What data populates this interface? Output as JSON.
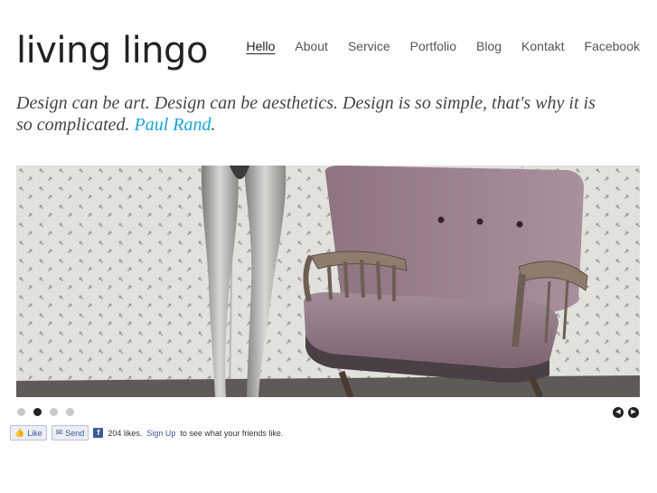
{
  "header": {
    "logo": "living lingo"
  },
  "nav": [
    {
      "label": "Hello",
      "active": true
    },
    {
      "label": "About"
    },
    {
      "label": "Service"
    },
    {
      "label": "Portfolio"
    },
    {
      "label": "Blog"
    },
    {
      "label": "Kontakt"
    },
    {
      "label": "Facebook"
    }
  ],
  "quote": {
    "text": "Design can be art. Design can be aesthetics. Design is so simple, that's why it is so complicated.",
    "author": "Paul Rand",
    "trailing": "."
  },
  "slider": {
    "slide_count": 4,
    "active_index": 1,
    "prev_icon": "arrow-left-icon",
    "next_icon": "arrow-right-icon"
  },
  "social": {
    "like_label": "Like",
    "send_label": "Send",
    "count_text": "204 likes.",
    "signup_link": "Sign Up",
    "signup_text": "to see what your friends like."
  },
  "colors": {
    "accent": "#1aa3d9",
    "facebook": "#3b5998"
  }
}
